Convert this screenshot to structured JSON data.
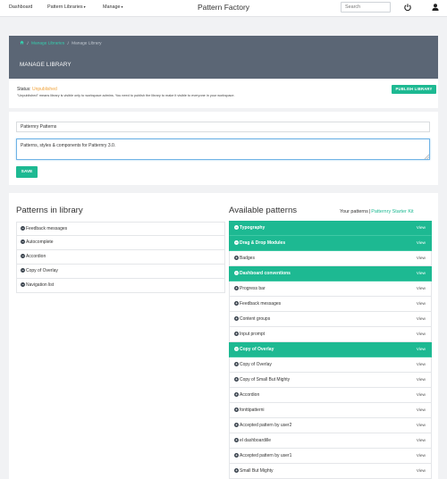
{
  "topbar": {
    "nav": [
      {
        "label": "Dashboard",
        "has_caret": false
      },
      {
        "label": "Pattern Libraries",
        "has_caret": true
      },
      {
        "label": "Manage",
        "has_caret": true
      }
    ],
    "brand": "Pattern Factory",
    "search_placeholder": "Search",
    "icons": [
      "power-icon",
      "user-icon"
    ]
  },
  "header": {
    "breadcrumb": {
      "home_icon": "home-icon",
      "link": "Manage Libraries",
      "current": "Manage Library",
      "separator": "/"
    },
    "title": "MANAGE LIBRARY"
  },
  "status": {
    "label": "Status:",
    "value": "Unpublished",
    "note": "\"Unpublished\" means library is visible only to workspace admins. You need to publish the library to make it visible to everyone in your workspace.",
    "publish_label": "PUBLISH LIBRARY"
  },
  "form": {
    "name_value": "Patternry Patterns",
    "description_value": "Patterns, styles & components for Patternry 3.0.",
    "save_label": "SAVE"
  },
  "library": {
    "title": "Patterns in library",
    "items": [
      {
        "label": "Feedback messages"
      },
      {
        "label": "Autocomplete"
      },
      {
        "label": "Accordion"
      },
      {
        "label": "Copy of Overlay"
      },
      {
        "label": "Navigation list"
      }
    ]
  },
  "available": {
    "title": "Available patterns",
    "your_patterns": "Your patterns",
    "separator": "|",
    "starter_kit": "Patternry Starter Kit",
    "view_label": "View",
    "items": [
      {
        "label": "Typography",
        "active": true,
        "icon": "minus"
      },
      {
        "label": "Drag & Drop Modules",
        "active": true,
        "icon": "minus"
      },
      {
        "label": "Badges",
        "active": false,
        "icon": "plus"
      },
      {
        "label": "Dashboard conventions",
        "active": true,
        "icon": "minus"
      },
      {
        "label": "Progress bar",
        "active": false,
        "icon": "plus"
      },
      {
        "label": "Feedback messages",
        "active": false,
        "icon": "plus"
      },
      {
        "label": "Content groups",
        "active": false,
        "icon": "plus"
      },
      {
        "label": "Input prompt",
        "active": false,
        "icon": "plus"
      },
      {
        "label": "Copy of Overlay",
        "active": true,
        "icon": "minus"
      },
      {
        "label": "Copy of Overlay",
        "active": false,
        "icon": "plus"
      },
      {
        "label": "Copy of Small But Mighty",
        "active": false,
        "icon": "plus"
      },
      {
        "label": "Accordion",
        "active": false,
        "icon": "plus"
      },
      {
        "label": "fonttipatterni",
        "active": false,
        "icon": "plus"
      },
      {
        "label": "Accepted pattern by user2",
        "active": false,
        "icon": "plus"
      },
      {
        "label": "el dashboardille",
        "active": false,
        "icon": "plus"
      },
      {
        "label": "Accepted pattern by user1",
        "active": false,
        "icon": "plus"
      },
      {
        "label": "Small But Mighty",
        "active": false,
        "icon": "plus"
      }
    ]
  },
  "colors": {
    "accent": "#1db992",
    "header_bg": "#5b6675",
    "status_unpublished": "#f0a23a",
    "page_bg": "#f1f2f4"
  }
}
